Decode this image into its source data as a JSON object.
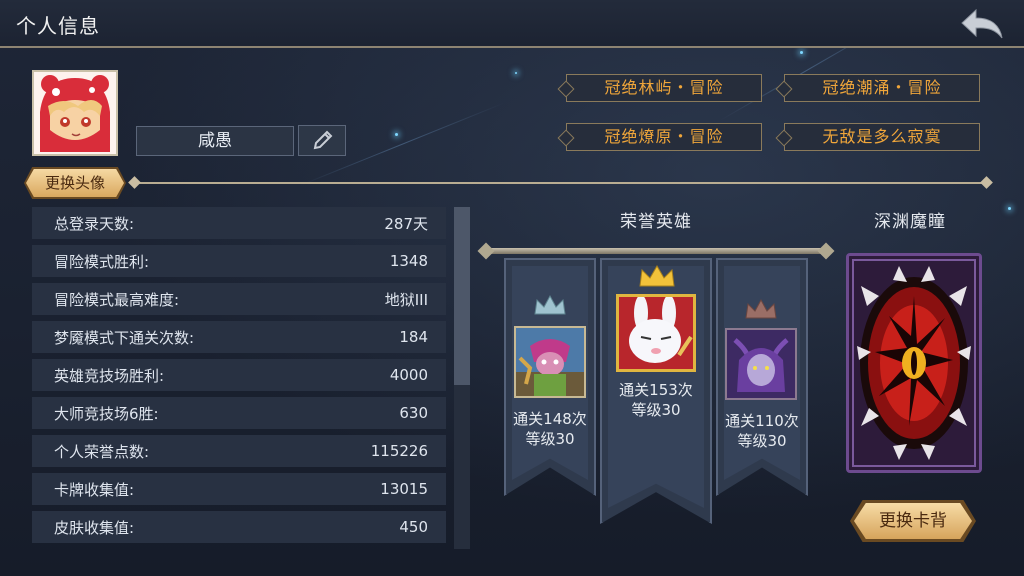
{
  "header": {
    "title": "个人信息",
    "back_icon": "back-arrow-icon"
  },
  "profile": {
    "name": "咸愚",
    "edit_icon": "pencil-icon",
    "change_avatar_label": "更换头像"
  },
  "titles": [
    {
      "label": "冠绝林屿・冒险"
    },
    {
      "label": "冠绝潮涌・冒险"
    },
    {
      "label": "冠绝燎原・冒险"
    },
    {
      "label": "无敌是多么寂寞"
    }
  ],
  "stats": [
    {
      "label": "总登录天数:",
      "value": "287天"
    },
    {
      "label": "冒险模式胜利:",
      "value": "1348"
    },
    {
      "label": "冒险模式最高难度:",
      "value": "地狱III"
    },
    {
      "label": "梦魇模式下通关次数:",
      "value": "184"
    },
    {
      "label": "英雄竞技场胜利:",
      "value": "4000"
    },
    {
      "label": "大师竞技场6胜:",
      "value": "630"
    },
    {
      "label": "个人荣誉点数:",
      "value": "115226"
    },
    {
      "label": "卡牌收集值:",
      "value": "13015"
    },
    {
      "label": "皮肤收集值:",
      "value": "450"
    }
  ],
  "honor": {
    "title": "荣誉英雄",
    "heroes": [
      {
        "clears": "通关148次",
        "level": "等级30",
        "crown": "silver-crown-icon"
      },
      {
        "clears": "通关153次",
        "level": "等级30",
        "crown": "gold-crown-icon"
      },
      {
        "clears": "通关110次",
        "level": "等级30",
        "crown": "bronze-crown-icon"
      }
    ]
  },
  "card_back": {
    "title": "深渊魔瞳",
    "change_label": "更换卡背"
  },
  "colors": {
    "title_text": "#f0a63a",
    "accent_gold": "#d9a85f"
  }
}
